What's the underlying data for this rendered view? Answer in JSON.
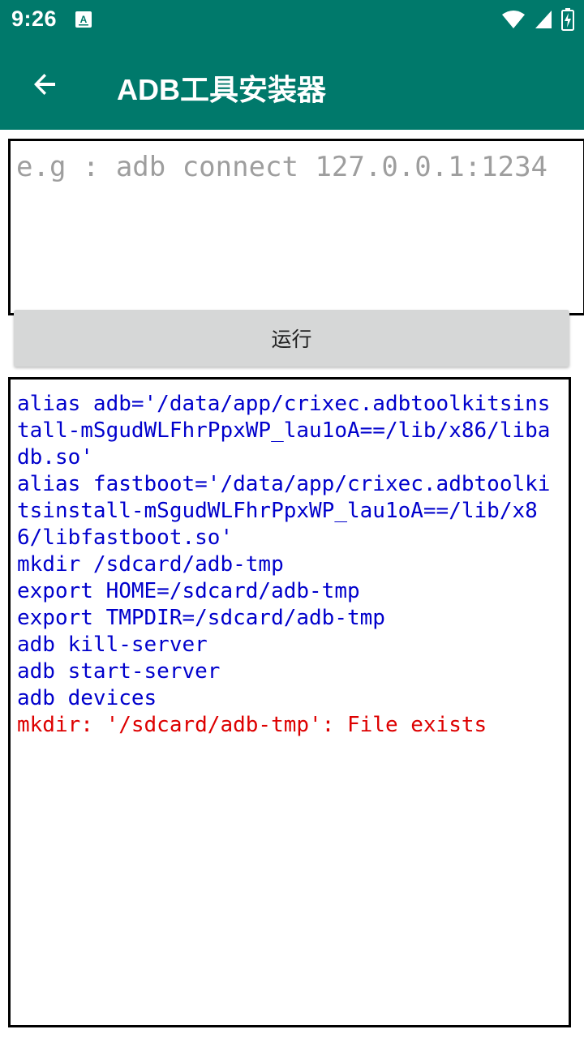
{
  "status_bar": {
    "time": "9:26",
    "icons": [
      "notification-a-icon",
      "wifi-icon",
      "signal-icon",
      "battery-charging-icon"
    ]
  },
  "toolbar": {
    "title": "ADB工具安装器",
    "back_icon": "arrow-back-icon"
  },
  "command_input": {
    "value": "",
    "placeholder": "e.g : adb connect 127.0.0.1:1234"
  },
  "run_button": {
    "label": "运行"
  },
  "output": {
    "lines": [
      {
        "text": "alias adb='/data/app/crixec.adbtoolkitsinstall-mSgudWLFhrPpxWP_lau1oA==/lib/x86/libadb.so'",
        "color": "#0000cc"
      },
      {
        "text": "alias fastboot='/data/app/crixec.adbtoolkitsinstall-mSgudWLFhrPpxWP_lau1oA==/lib/x86/libfastboot.so'",
        "color": "#0000cc"
      },
      {
        "text": "mkdir /sdcard/adb-tmp",
        "color": "#0000cc"
      },
      {
        "text": "export HOME=/sdcard/adb-tmp",
        "color": "#0000cc"
      },
      {
        "text": "export TMPDIR=/sdcard/adb-tmp",
        "color": "#0000cc"
      },
      {
        "text": "adb kill-server",
        "color": "#0000cc"
      },
      {
        "text": "adb start-server",
        "color": "#0000cc"
      },
      {
        "text": "adb devices",
        "color": "#0000cc"
      },
      {
        "text": "mkdir: '/sdcard/adb-tmp': File exists",
        "color": "#dd0000"
      }
    ]
  },
  "colors": {
    "primary": "#00796b",
    "command_text": "#0000cc",
    "error_text": "#dd0000"
  }
}
